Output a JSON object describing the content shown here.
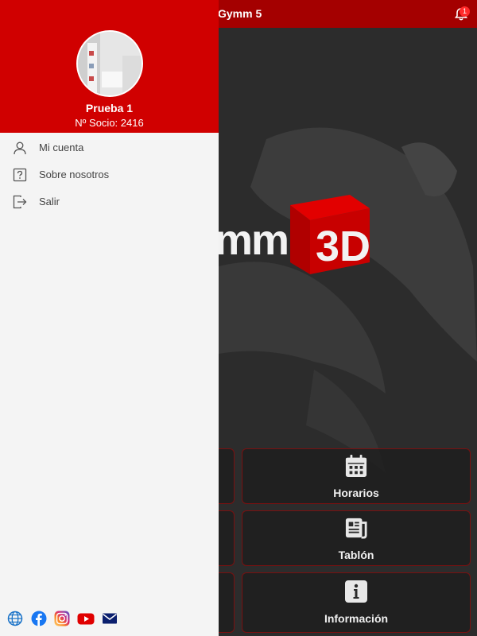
{
  "app": {
    "title": "Gymm 5",
    "notification_count": "1",
    "logo_text": "mm",
    "logo_cube_text": "3D"
  },
  "tiles": [
    {
      "label": "Horarios",
      "icon": "calendar-icon"
    },
    {
      "label": "Tablón",
      "icon": "newspaper-icon"
    },
    {
      "label": "Información",
      "icon": "info-icon"
    }
  ],
  "drawer": {
    "user_name": "Prueba 1",
    "member_number": "Nº Socio: 2416",
    "menu": [
      {
        "label": "Mi cuenta",
        "icon": "user-icon"
      },
      {
        "label": "Sobre nosotros",
        "icon": "question-icon"
      },
      {
        "label": "Salir",
        "icon": "logout-icon"
      }
    ],
    "social": [
      "globe-icon",
      "facebook-icon",
      "instagram-icon",
      "youtube-icon",
      "mail-icon"
    ]
  },
  "colors": {
    "drawer_header": "#d00000",
    "topbar": "#a40000",
    "tile_border": "#7a1010"
  }
}
